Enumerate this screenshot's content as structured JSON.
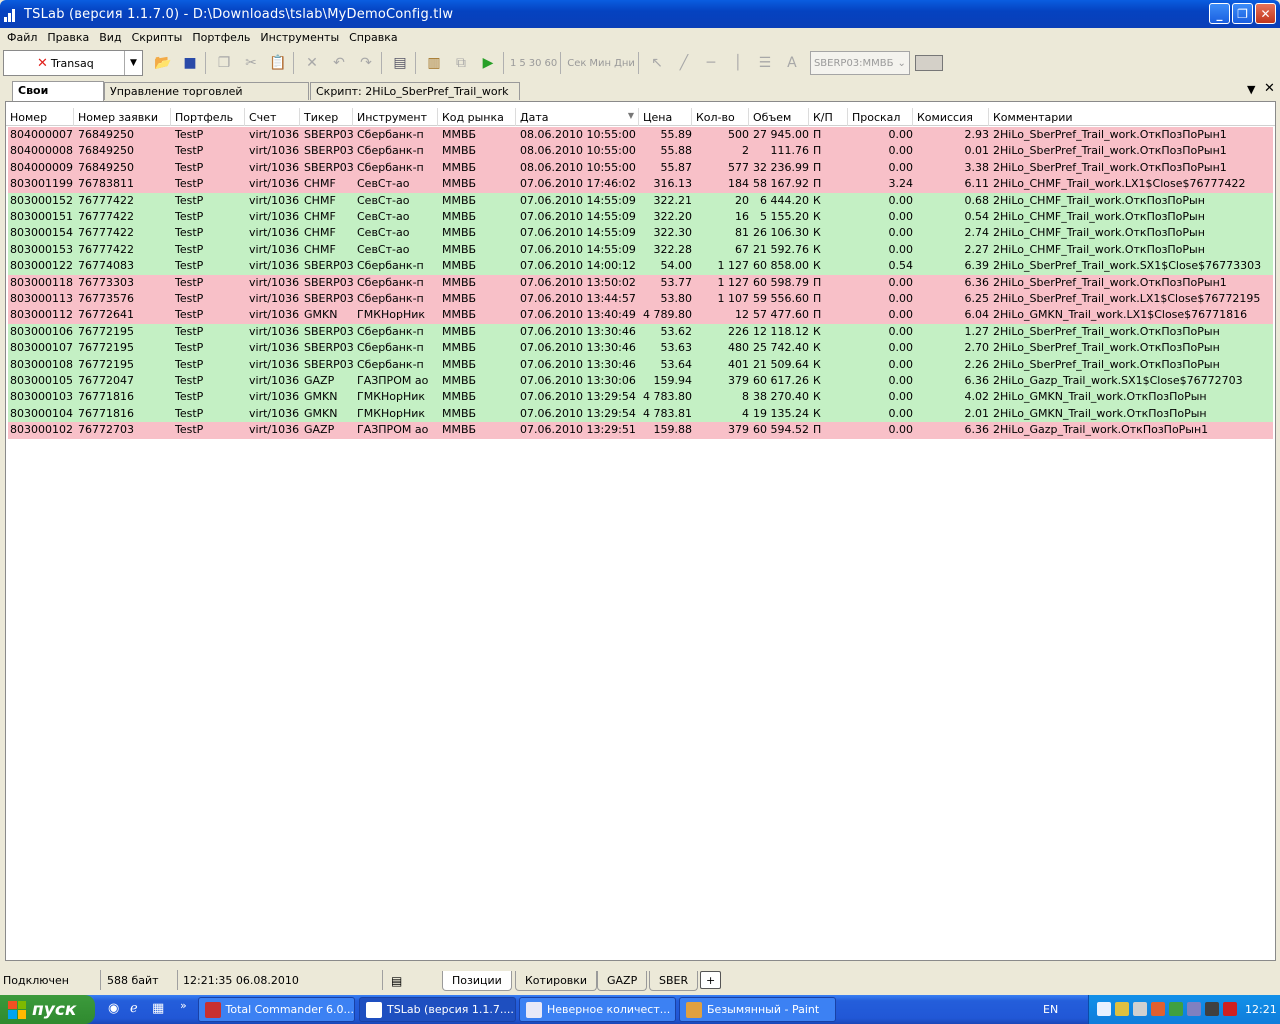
{
  "window": {
    "title": "TSLab (версия 1.1.7.0) - D:\\Downloads\\tslab\\MyDemoConfig.tlw"
  },
  "menu": [
    "Файл",
    "Правка",
    "Вид",
    "Скрипты",
    "Портфель",
    "Инструменты",
    "Справка"
  ],
  "toolbar": {
    "connector": "Transaq",
    "intervals": [
      "1",
      "5",
      "30",
      "60"
    ],
    "units": [
      "Сек",
      "Мин",
      "Дни"
    ],
    "instrument": "SBERP03:ММВБ"
  },
  "tabs": [
    "Свои сделки",
    "Управление торговлей скриптами",
    "Скрипт: 2HiLo_SberPref_Trail_work"
  ],
  "grid": {
    "columns": [
      "Номер",
      "Номер заявки",
      "Портфель",
      "Счет",
      "Тикер",
      "Инструмент",
      "Код рынка",
      "Дата",
      "Цена",
      "Кол-во",
      "Объем",
      "К/П",
      "Проскал",
      "Комиссия",
      "Комментарии"
    ],
    "colors": {
      "sell": "#f8c0c8",
      "buy": "#c4f0c4"
    },
    "rows": [
      {
        "id": "804000007",
        "order": "76849250",
        "portfolio": "TestP",
        "account": "virt/1036",
        "ticker": "SBERP03",
        "instrument": "Сбербанк-п",
        "market": "ММВБ",
        "date": "08.06.2010 10:55:00",
        "price": "55.89",
        "qty": "500",
        "volume": "27 945.00",
        "side": "П",
        "slip": "0.00",
        "commission": "2.93",
        "comment": "2HiLo_SberPref_Trail_work.ОткПозПоРын1"
      },
      {
        "id": "804000008",
        "order": "76849250",
        "portfolio": "TestP",
        "account": "virt/1036",
        "ticker": "SBERP03",
        "instrument": "Сбербанк-п",
        "market": "ММВБ",
        "date": "08.06.2010 10:55:00",
        "price": "55.88",
        "qty": "2",
        "volume": "111.76",
        "side": "П",
        "slip": "0.00",
        "commission": "0.01",
        "comment": "2HiLo_SberPref_Trail_work.ОткПозПоРын1"
      },
      {
        "id": "804000009",
        "order": "76849250",
        "portfolio": "TestP",
        "account": "virt/1036",
        "ticker": "SBERP03",
        "instrument": "Сбербанк-п",
        "market": "ММВБ",
        "date": "08.06.2010 10:55:00",
        "price": "55.87",
        "qty": "577",
        "volume": "32 236.99",
        "side": "П",
        "slip": "0.00",
        "commission": "3.38",
        "comment": "2HiLo_SberPref_Trail_work.ОткПозПоРын1"
      },
      {
        "id": "803001199",
        "order": "76783811",
        "portfolio": "TestP",
        "account": "virt/1036",
        "ticker": "CHMF",
        "instrument": "СевСт-ао",
        "market": "ММВБ",
        "date": "07.06.2010 17:46:02",
        "price": "316.13",
        "qty": "184",
        "volume": "58 167.92",
        "side": "П",
        "slip": "3.24",
        "commission": "6.11",
        "comment": "2HiLo_CHMF_Trail_work.LX1$Close$76777422"
      },
      {
        "id": "803000152",
        "order": "76777422",
        "portfolio": "TestP",
        "account": "virt/1036",
        "ticker": "CHMF",
        "instrument": "СевСт-ао",
        "market": "ММВБ",
        "date": "07.06.2010 14:55:09",
        "price": "322.21",
        "qty": "20",
        "volume": "6 444.20",
        "side": "К",
        "slip": "0.00",
        "commission": "0.68",
        "comment": "2HiLo_CHMF_Trail_work.ОткПозПоРын"
      },
      {
        "id": "803000151",
        "order": "76777422",
        "portfolio": "TestP",
        "account": "virt/1036",
        "ticker": "CHMF",
        "instrument": "СевСт-ао",
        "market": "ММВБ",
        "date": "07.06.2010 14:55:09",
        "price": "322.20",
        "qty": "16",
        "volume": "5 155.20",
        "side": "К",
        "slip": "0.00",
        "commission": "0.54",
        "comment": "2HiLo_CHMF_Trail_work.ОткПозПоРын"
      },
      {
        "id": "803000154",
        "order": "76777422",
        "portfolio": "TestP",
        "account": "virt/1036",
        "ticker": "CHMF",
        "instrument": "СевСт-ао",
        "market": "ММВБ",
        "date": "07.06.2010 14:55:09",
        "price": "322.30",
        "qty": "81",
        "volume": "26 106.30",
        "side": "К",
        "slip": "0.00",
        "commission": "2.74",
        "comment": "2HiLo_CHMF_Trail_work.ОткПозПоРын"
      },
      {
        "id": "803000153",
        "order": "76777422",
        "portfolio": "TestP",
        "account": "virt/1036",
        "ticker": "CHMF",
        "instrument": "СевСт-ао",
        "market": "ММВБ",
        "date": "07.06.2010 14:55:09",
        "price": "322.28",
        "qty": "67",
        "volume": "21 592.76",
        "side": "К",
        "slip": "0.00",
        "commission": "2.27",
        "comment": "2HiLo_CHMF_Trail_work.ОткПозПоРын"
      },
      {
        "id": "803000122",
        "order": "76774083",
        "portfolio": "TestP",
        "account": "virt/1036",
        "ticker": "SBERP03",
        "instrument": "Сбербанк-п",
        "market": "ММВБ",
        "date": "07.06.2010 14:00:12",
        "price": "54.00",
        "qty": "1 127",
        "volume": "60 858.00",
        "side": "К",
        "slip": "0.54",
        "commission": "6.39",
        "comment": "2HiLo_SberPref_Trail_work.SX1$Close$76773303"
      },
      {
        "id": "803000118",
        "order": "76773303",
        "portfolio": "TestP",
        "account": "virt/1036",
        "ticker": "SBERP03",
        "instrument": "Сбербанк-п",
        "market": "ММВБ",
        "date": "07.06.2010 13:50:02",
        "price": "53.77",
        "qty": "1 127",
        "volume": "60 598.79",
        "side": "П",
        "slip": "0.00",
        "commission": "6.36",
        "comment": "2HiLo_SberPref_Trail_work.ОткПозПоРын1"
      },
      {
        "id": "803000113",
        "order": "76773576",
        "portfolio": "TestP",
        "account": "virt/1036",
        "ticker": "SBERP03",
        "instrument": "Сбербанк-п",
        "market": "ММВБ",
        "date": "07.06.2010 13:44:57",
        "price": "53.80",
        "qty": "1 107",
        "volume": "59 556.60",
        "side": "П",
        "slip": "0.00",
        "commission": "6.25",
        "comment": "2HiLo_SberPref_Trail_work.LX1$Close$76772195"
      },
      {
        "id": "803000112",
        "order": "76772641",
        "portfolio": "TestP",
        "account": "virt/1036",
        "ticker": "GMKN",
        "instrument": "ГМКНорНик",
        "market": "ММВБ",
        "date": "07.06.2010 13:40:49",
        "price": "4 789.80",
        "qty": "12",
        "volume": "57 477.60",
        "side": "П",
        "slip": "0.00",
        "commission": "6.04",
        "comment": "2HiLo_GMKN_Trail_work.LX1$Close$76771816"
      },
      {
        "id": "803000106",
        "order": "76772195",
        "portfolio": "TestP",
        "account": "virt/1036",
        "ticker": "SBERP03",
        "instrument": "Сбербанк-п",
        "market": "ММВБ",
        "date": "07.06.2010 13:30:46",
        "price": "53.62",
        "qty": "226",
        "volume": "12 118.12",
        "side": "К",
        "slip": "0.00",
        "commission": "1.27",
        "comment": "2HiLo_SberPref_Trail_work.ОткПозПоРын"
      },
      {
        "id": "803000107",
        "order": "76772195",
        "portfolio": "TestP",
        "account": "virt/1036",
        "ticker": "SBERP03",
        "instrument": "Сбербанк-п",
        "market": "ММВБ",
        "date": "07.06.2010 13:30:46",
        "price": "53.63",
        "qty": "480",
        "volume": "25 742.40",
        "side": "К",
        "slip": "0.00",
        "commission": "2.70",
        "comment": "2HiLo_SberPref_Trail_work.ОткПозПоРын"
      },
      {
        "id": "803000108",
        "order": "76772195",
        "portfolio": "TestP",
        "account": "virt/1036",
        "ticker": "SBERP03",
        "instrument": "Сбербанк-п",
        "market": "ММВБ",
        "date": "07.06.2010 13:30:46",
        "price": "53.64",
        "qty": "401",
        "volume": "21 509.64",
        "side": "К",
        "slip": "0.00",
        "commission": "2.26",
        "comment": "2HiLo_SberPref_Trail_work.ОткПозПоРын"
      },
      {
        "id": "803000105",
        "order": "76772047",
        "portfolio": "TestP",
        "account": "virt/1036",
        "ticker": "GAZP",
        "instrument": "ГАЗПРОМ ао",
        "market": "ММВБ",
        "date": "07.06.2010 13:30:06",
        "price": "159.94",
        "qty": "379",
        "volume": "60 617.26",
        "side": "К",
        "slip": "0.00",
        "commission": "6.36",
        "comment": "2HiLo_Gazp_Trail_work.SX1$Close$76772703"
      },
      {
        "id": "803000103",
        "order": "76771816",
        "portfolio": "TestP",
        "account": "virt/1036",
        "ticker": "GMKN",
        "instrument": "ГМКНорНик",
        "market": "ММВБ",
        "date": "07.06.2010 13:29:54",
        "price": "4 783.80",
        "qty": "8",
        "volume": "38 270.40",
        "side": "К",
        "slip": "0.00",
        "commission": "4.02",
        "comment": "2HiLo_GMKN_Trail_work.ОткПозПоРын"
      },
      {
        "id": "803000104",
        "order": "76771816",
        "portfolio": "TestP",
        "account": "virt/1036",
        "ticker": "GMKN",
        "instrument": "ГМКНорНик",
        "market": "ММВБ",
        "date": "07.06.2010 13:29:54",
        "price": "4 783.81",
        "qty": "4",
        "volume": "19 135.24",
        "side": "К",
        "slip": "0.00",
        "commission": "2.01",
        "comment": "2HiLo_GMKN_Trail_work.ОткПозПоРын"
      },
      {
        "id": "803000102",
        "order": "76772703",
        "portfolio": "TestP",
        "account": "virt/1036",
        "ticker": "GAZP",
        "instrument": "ГАЗПРОМ ао",
        "market": "ММВБ",
        "date": "07.06.2010 13:29:51",
        "price": "159.88",
        "qty": "379",
        "volume": "60 594.52",
        "side": "П",
        "slip": "0.00",
        "commission": "6.36",
        "comment": "2HiLo_Gazp_Trail_work.ОткПозПоРын1"
      }
    ]
  },
  "status": {
    "connection": "Подключен",
    "bytes": "588 байт",
    "datetime": "12:21:35 06.08.2010"
  },
  "bottom_tabs": [
    "Позиции",
    "Котировки",
    "GAZP",
    "SBER",
    "+"
  ],
  "taskbar": {
    "start": "пуск",
    "tasks": [
      "Total Commander 6.0...",
      "TSLab (версия 1.1.7....",
      "Неверное количест...",
      "Безымянный - Paint"
    ],
    "lang": "EN",
    "clock": "12:21"
  }
}
